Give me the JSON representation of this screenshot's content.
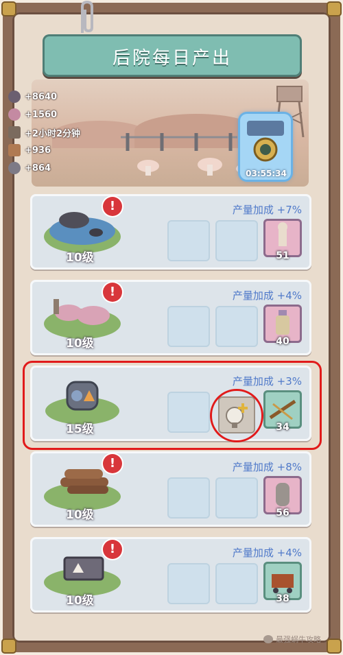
{
  "title": "后院每日产出",
  "stats": [
    {
      "icon": "magnifier-icon",
      "value": "+8640"
    },
    {
      "icon": "mushroom-icon",
      "value": "+1560"
    },
    {
      "icon": "hourglass-icon",
      "value": "+2小时2分钟"
    },
    {
      "icon": "wood-icon",
      "value": "+936"
    },
    {
      "icon": "stone-icon",
      "value": "+864"
    }
  ],
  "timer": "03:55:34",
  "bonus_label": "产量加成",
  "rows": [
    {
      "name": "pond",
      "level": "10级",
      "bonus": "+7%",
      "item_count": "51",
      "item_color": "#e7b4c8",
      "item_icon": "statue-icon"
    },
    {
      "name": "mushroom-farm",
      "level": "10级",
      "bonus": "+4%",
      "item_count": "40",
      "item_color": "#e7b4c8",
      "item_icon": "potion-icon"
    },
    {
      "name": "machine",
      "level": "15级",
      "bonus": "+3%",
      "item_count": "34",
      "item_color": "#9fd0c2",
      "item_icon": "crossbow-icon"
    },
    {
      "name": "lumber",
      "level": "10级",
      "bonus": "+8%",
      "item_count": "56",
      "item_color": "#e7b4c8",
      "item_icon": "tombstone-icon"
    },
    {
      "name": "mine",
      "level": "10级",
      "bonus": "+4%",
      "item_count": "38",
      "item_color": "#9fd0c2",
      "item_icon": "mine-cart-icon"
    }
  ],
  "watermark": "最强蜗牛攻略"
}
